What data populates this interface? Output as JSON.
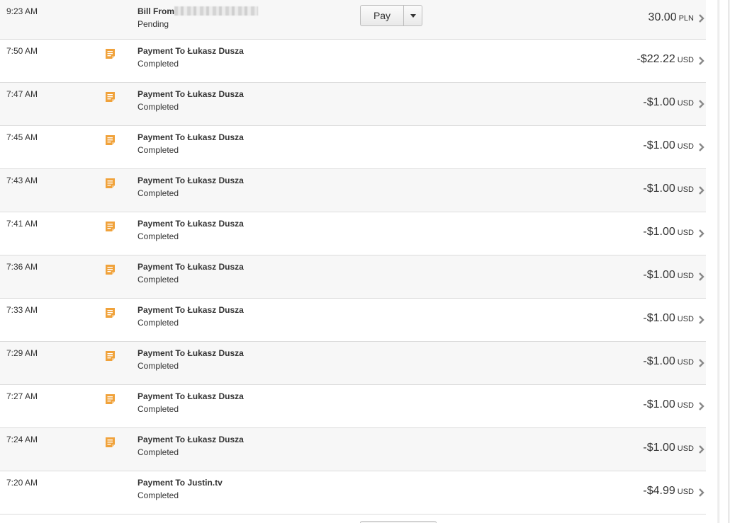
{
  "icons": {
    "note": "note-icon",
    "chevron": "chevron-right-icon",
    "caret": "caret-down-icon"
  },
  "colors": {
    "note_icon": "#f0a23b",
    "chevron": "#888888",
    "row_alt": "#f7f7f7",
    "divider": "#dcdcdc"
  },
  "pending": {
    "time": "9:23 AM",
    "title_prefix": "Bill From",
    "status": "Pending",
    "pay_label": "Pay",
    "amount": "30.00",
    "currency": "PLN"
  },
  "transactions": [
    {
      "time": "7:50 AM",
      "title": "Payment To Łukasz Dusza",
      "status": "Completed",
      "amount": "-$22.22",
      "currency": "USD",
      "icon": true
    },
    {
      "time": "7:47 AM",
      "title": "Payment To Łukasz Dusza",
      "status": "Completed",
      "amount": "-$1.00",
      "currency": "USD",
      "icon": true
    },
    {
      "time": "7:45 AM",
      "title": "Payment To Łukasz Dusza",
      "status": "Completed",
      "amount": "-$1.00",
      "currency": "USD",
      "icon": true
    },
    {
      "time": "7:43 AM",
      "title": "Payment To Łukasz Dusza",
      "status": "Completed",
      "amount": "-$1.00",
      "currency": "USD",
      "icon": true
    },
    {
      "time": "7:41 AM",
      "title": "Payment To Łukasz Dusza",
      "status": "Completed",
      "amount": "-$1.00",
      "currency": "USD",
      "icon": true
    },
    {
      "time": "7:36 AM",
      "title": "Payment To Łukasz Dusza",
      "status": "Completed",
      "amount": "-$1.00",
      "currency": "USD",
      "icon": true
    },
    {
      "time": "7:33 AM",
      "title": "Payment To Łukasz Dusza",
      "status": "Completed",
      "amount": "-$1.00",
      "currency": "USD",
      "icon": true
    },
    {
      "time": "7:29 AM",
      "title": "Payment To Łukasz Dusza",
      "status": "Completed",
      "amount": "-$1.00",
      "currency": "USD",
      "icon": true
    },
    {
      "time": "7:27 AM",
      "title": "Payment To Łukasz Dusza",
      "status": "Completed",
      "amount": "-$1.00",
      "currency": "USD",
      "icon": true
    },
    {
      "time": "7:24 AM",
      "title": "Payment To Łukasz Dusza",
      "status": "Completed",
      "amount": "-$1.00",
      "currency": "USD",
      "icon": true
    },
    {
      "time": "7:20 AM",
      "title": "Payment To Justin.tv",
      "status": "Completed",
      "amount": "-$4.99",
      "currency": "USD",
      "icon": false
    }
  ]
}
